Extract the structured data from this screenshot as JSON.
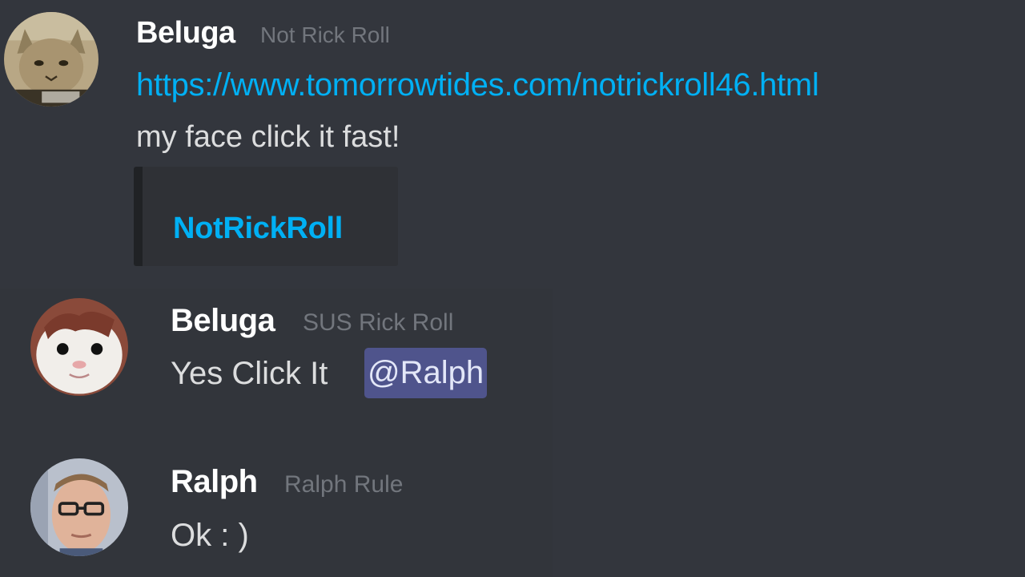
{
  "messages": [
    {
      "author": "Beluga",
      "tag": "Not Rick Roll",
      "avatar": "cat-avatar",
      "link": "https://www.tomorrowtides.com/notrickroll46.html",
      "text": "my face click it fast!",
      "embed_title": "NotRickRoll"
    },
    {
      "author": "Beluga",
      "tag": "SUS Rick Roll",
      "avatar": "beluga-cat-avatar",
      "text": "Yes Click It",
      "mention": "@Ralph"
    },
    {
      "author": "Ralph",
      "tag": "Ralph Rule",
      "avatar": "person-with-glasses-avatar",
      "text": "Ok : )"
    }
  ],
  "colors": {
    "background": "#33363d",
    "link": "#00b0f4",
    "mention_bg": "#4f548c",
    "username": "#ffffff",
    "tag": "#72767d",
    "message_text": "#dcddde"
  }
}
